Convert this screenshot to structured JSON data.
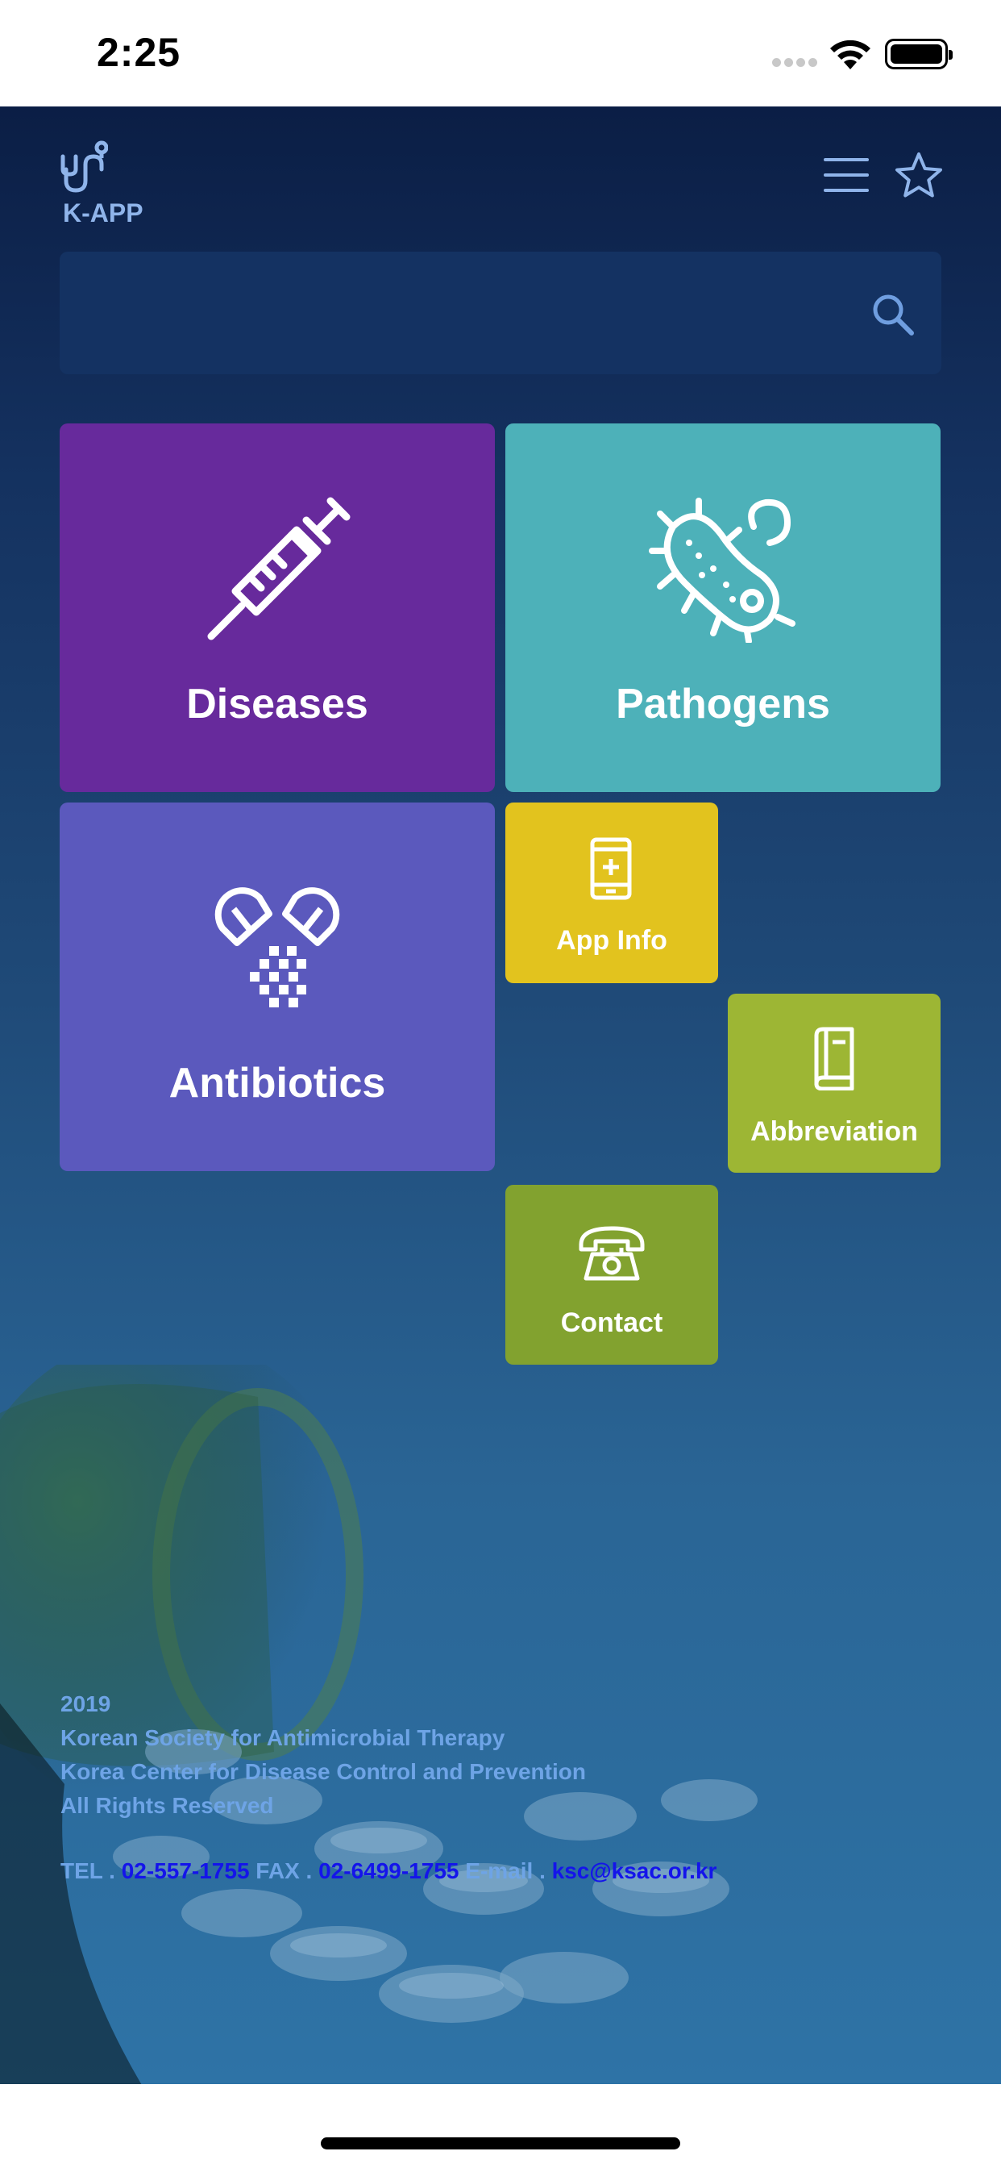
{
  "status_bar": {
    "time": "2:25"
  },
  "header": {
    "app_name": "K-APP"
  },
  "search": {
    "placeholder": "",
    "value": ""
  },
  "tiles": [
    {
      "label": "Diseases",
      "color": "#672a9c",
      "icon": "syringe-icon"
    },
    {
      "label": "Pathogens",
      "color": "#4db1b9",
      "icon": "bacteria-icon"
    },
    {
      "label": "Antibiotics",
      "color": "#5b59bd",
      "icon": "capsule-icon"
    },
    {
      "label": "App Info",
      "color": "#e2c31e",
      "icon": "phone-info-icon"
    },
    {
      "label": "Abbreviation",
      "color": "#9db634",
      "icon": "book-icon"
    },
    {
      "label": "Contact",
      "color": "#82a22f",
      "icon": "telephone-icon"
    }
  ],
  "footer": {
    "year": "2019",
    "org1": "Korean Society for Antimicrobial Therapy",
    "org2": "Korea Center for Disease Control and Prevention",
    "rights": "All Rights Reserved",
    "tel_label": "TEL . ",
    "tel": "02-557-1755",
    "fax_label": " FAX . ",
    "fax": "02-6499-1755",
    "email_label": " E-mail . ",
    "email": "ksc@ksac.or.kr"
  },
  "colors": {
    "accent": "#8fb4ea",
    "link": "#1414ea",
    "footer_text": "#6ea4e6"
  }
}
